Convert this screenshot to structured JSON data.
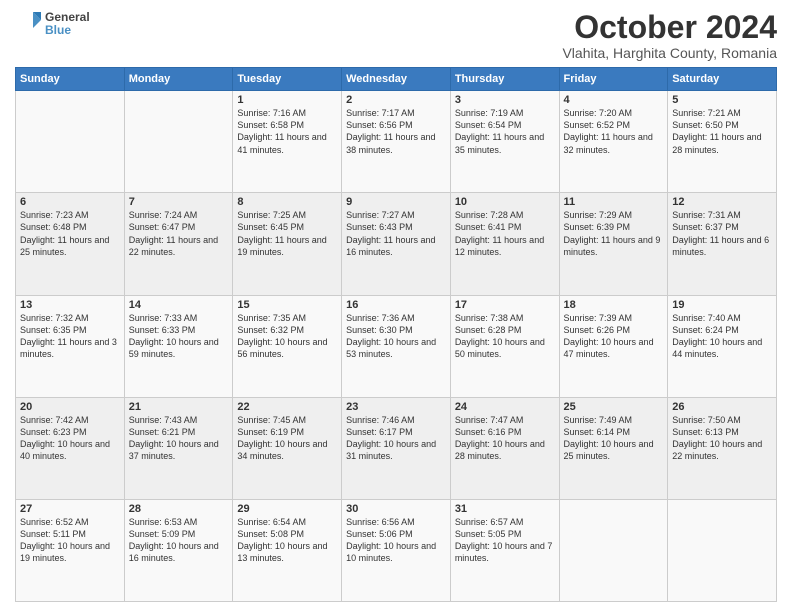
{
  "logo": {
    "general": "General",
    "blue": "Blue"
  },
  "header": {
    "month": "October 2024",
    "location": "Vlahita, Harghita County, Romania"
  },
  "weekdays": [
    "Sunday",
    "Monday",
    "Tuesday",
    "Wednesday",
    "Thursday",
    "Friday",
    "Saturday"
  ],
  "weeks": [
    [
      {
        "day": "",
        "info": ""
      },
      {
        "day": "",
        "info": ""
      },
      {
        "day": "1",
        "info": "Sunrise: 7:16 AM\nSunset: 6:58 PM\nDaylight: 11 hours and 41 minutes."
      },
      {
        "day": "2",
        "info": "Sunrise: 7:17 AM\nSunset: 6:56 PM\nDaylight: 11 hours and 38 minutes."
      },
      {
        "day": "3",
        "info": "Sunrise: 7:19 AM\nSunset: 6:54 PM\nDaylight: 11 hours and 35 minutes."
      },
      {
        "day": "4",
        "info": "Sunrise: 7:20 AM\nSunset: 6:52 PM\nDaylight: 11 hours and 32 minutes."
      },
      {
        "day": "5",
        "info": "Sunrise: 7:21 AM\nSunset: 6:50 PM\nDaylight: 11 hours and 28 minutes."
      }
    ],
    [
      {
        "day": "6",
        "info": "Sunrise: 7:23 AM\nSunset: 6:48 PM\nDaylight: 11 hours and 25 minutes."
      },
      {
        "day": "7",
        "info": "Sunrise: 7:24 AM\nSunset: 6:47 PM\nDaylight: 11 hours and 22 minutes."
      },
      {
        "day": "8",
        "info": "Sunrise: 7:25 AM\nSunset: 6:45 PM\nDaylight: 11 hours and 19 minutes."
      },
      {
        "day": "9",
        "info": "Sunrise: 7:27 AM\nSunset: 6:43 PM\nDaylight: 11 hours and 16 minutes."
      },
      {
        "day": "10",
        "info": "Sunrise: 7:28 AM\nSunset: 6:41 PM\nDaylight: 11 hours and 12 minutes."
      },
      {
        "day": "11",
        "info": "Sunrise: 7:29 AM\nSunset: 6:39 PM\nDaylight: 11 hours and 9 minutes."
      },
      {
        "day": "12",
        "info": "Sunrise: 7:31 AM\nSunset: 6:37 PM\nDaylight: 11 hours and 6 minutes."
      }
    ],
    [
      {
        "day": "13",
        "info": "Sunrise: 7:32 AM\nSunset: 6:35 PM\nDaylight: 11 hours and 3 minutes."
      },
      {
        "day": "14",
        "info": "Sunrise: 7:33 AM\nSunset: 6:33 PM\nDaylight: 10 hours and 59 minutes."
      },
      {
        "day": "15",
        "info": "Sunrise: 7:35 AM\nSunset: 6:32 PM\nDaylight: 10 hours and 56 minutes."
      },
      {
        "day": "16",
        "info": "Sunrise: 7:36 AM\nSunset: 6:30 PM\nDaylight: 10 hours and 53 minutes."
      },
      {
        "day": "17",
        "info": "Sunrise: 7:38 AM\nSunset: 6:28 PM\nDaylight: 10 hours and 50 minutes."
      },
      {
        "day": "18",
        "info": "Sunrise: 7:39 AM\nSunset: 6:26 PM\nDaylight: 10 hours and 47 minutes."
      },
      {
        "day": "19",
        "info": "Sunrise: 7:40 AM\nSunset: 6:24 PM\nDaylight: 10 hours and 44 minutes."
      }
    ],
    [
      {
        "day": "20",
        "info": "Sunrise: 7:42 AM\nSunset: 6:23 PM\nDaylight: 10 hours and 40 minutes."
      },
      {
        "day": "21",
        "info": "Sunrise: 7:43 AM\nSunset: 6:21 PM\nDaylight: 10 hours and 37 minutes."
      },
      {
        "day": "22",
        "info": "Sunrise: 7:45 AM\nSunset: 6:19 PM\nDaylight: 10 hours and 34 minutes."
      },
      {
        "day": "23",
        "info": "Sunrise: 7:46 AM\nSunset: 6:17 PM\nDaylight: 10 hours and 31 minutes."
      },
      {
        "day": "24",
        "info": "Sunrise: 7:47 AM\nSunset: 6:16 PM\nDaylight: 10 hours and 28 minutes."
      },
      {
        "day": "25",
        "info": "Sunrise: 7:49 AM\nSunset: 6:14 PM\nDaylight: 10 hours and 25 minutes."
      },
      {
        "day": "26",
        "info": "Sunrise: 7:50 AM\nSunset: 6:13 PM\nDaylight: 10 hours and 22 minutes."
      }
    ],
    [
      {
        "day": "27",
        "info": "Sunrise: 6:52 AM\nSunset: 5:11 PM\nDaylight: 10 hours and 19 minutes."
      },
      {
        "day": "28",
        "info": "Sunrise: 6:53 AM\nSunset: 5:09 PM\nDaylight: 10 hours and 16 minutes."
      },
      {
        "day": "29",
        "info": "Sunrise: 6:54 AM\nSunset: 5:08 PM\nDaylight: 10 hours and 13 minutes."
      },
      {
        "day": "30",
        "info": "Sunrise: 6:56 AM\nSunset: 5:06 PM\nDaylight: 10 hours and 10 minutes."
      },
      {
        "day": "31",
        "info": "Sunrise: 6:57 AM\nSunset: 5:05 PM\nDaylight: 10 hours and 7 minutes."
      },
      {
        "day": "",
        "info": ""
      },
      {
        "day": "",
        "info": ""
      }
    ]
  ]
}
